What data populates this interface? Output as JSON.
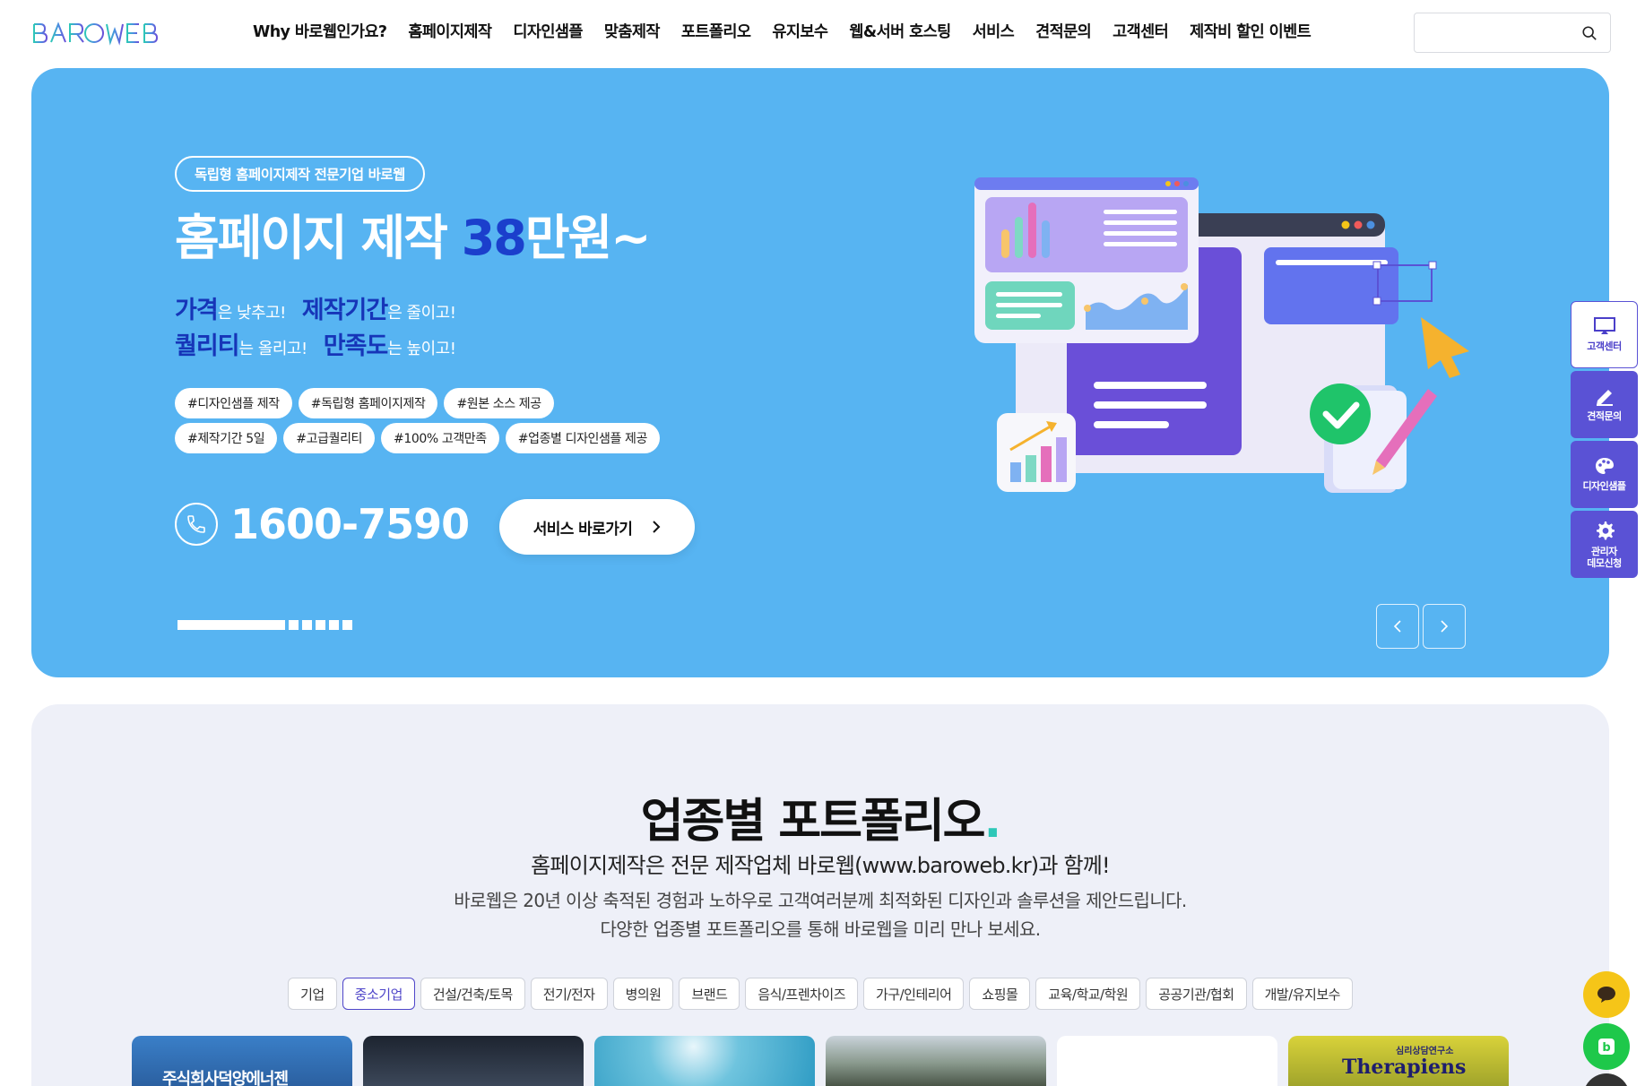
{
  "header": {
    "logo_text": "BAROWEB",
    "nav": [
      "Why 바로웹인가요?",
      "홈페이지제작",
      "디자인샘플",
      "맞춤제작",
      "포트폴리오",
      "유지보수",
      "웹&서버 호스팅",
      "서비스",
      "견적문의",
      "고객센터",
      "제작비 할인 이벤트"
    ],
    "search_placeholder": ""
  },
  "hero": {
    "badge": "독립형 홈페이지제작 전문기업 바로웹",
    "title_prefix": "홈페이지 제작 ",
    "title_price": "38",
    "title_suffix": "만원~",
    "line1": {
      "w1": "가격",
      "t1": "은 낮추고!",
      "w2": "제작기간",
      "t2": "은 줄이고!"
    },
    "line2": {
      "w1": "퀄리티",
      "t1": "는 올리고!",
      "w2": "만족도",
      "t2": "는 높이고!"
    },
    "tags_row1": [
      "#디자인샘플 제작",
      "#독립형 홈페이지제작",
      "#원본 소스 제공"
    ],
    "tags_row2": [
      "#제작기간 5일",
      "#고급퀄리티",
      "#100% 고객만족",
      "#업종별 디자인샘플 제공"
    ],
    "phone": "1600-7590",
    "service_button": "서비스 바로가기",
    "slides": {
      "current": 1,
      "total": 6
    }
  },
  "side_menu": [
    {
      "label": "고객센터",
      "icon": "monitor-icon"
    },
    {
      "label": "견적문의",
      "icon": "pencil-icon"
    },
    {
      "label": "디자인샘플",
      "icon": "palette-icon"
    },
    {
      "label": "관리자\n데모신청",
      "icon": "gear-icon"
    }
  ],
  "portfolio": {
    "title": "업종별 포트폴리오",
    "title_dot": ".",
    "subtitle": "홈페이지제작은 전문 제작업체 바로웹(www.baroweb.kr)과 함께!",
    "desc1": "바로웹은 20년 이상 축적된 경험과 노하우로 고객여러분께 최적화된 디자인과 솔루션을 제안드립니다.",
    "desc2": "다양한 업종별 포트폴리오를 통해 바로웹을 미리 만나 보세요.",
    "filters": [
      "기업",
      "중소기업",
      "건설/건축/토목",
      "전기/전자",
      "병의원",
      "브랜드",
      "음식/프렌차이즈",
      "가구/인테리어",
      "쇼핑몰",
      "교육/학교/학원",
      "공공기관/협회",
      "개발/유지보수"
    ],
    "active_filter": 1,
    "thumb_texts": [
      "주식회사덕양에너젠",
      "",
      "",
      "",
      "",
      "Therapiens"
    ],
    "thumb_sub": [
      "",
      "",
      "",
      "",
      "",
      "심리상담연구소"
    ]
  },
  "colors": {
    "hero_bg": "#57b4f2",
    "accent": "#5a52d5",
    "price": "#1b3fcc",
    "teal_dot": "#2ec7b8",
    "chat_yellow": "#f5c518",
    "blog_green": "#1ec84a"
  }
}
